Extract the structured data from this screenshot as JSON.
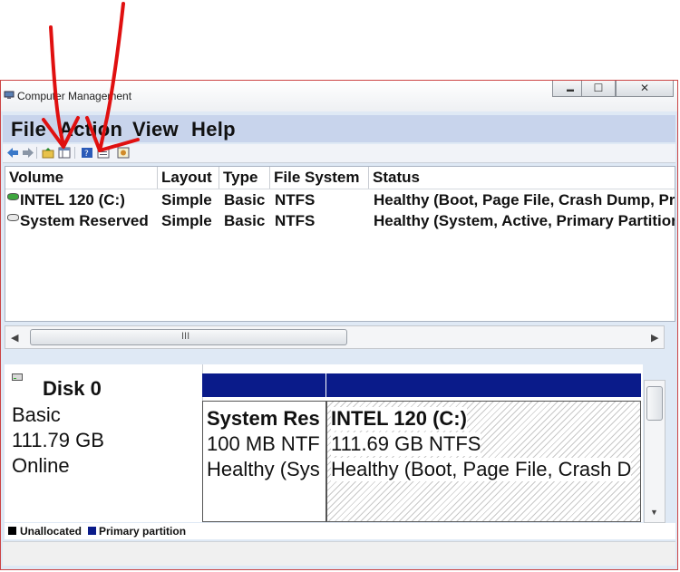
{
  "window": {
    "title": "Computer Management"
  },
  "caption_buttons": {
    "minimize": "▬",
    "maximize": "☐",
    "close": "✕"
  },
  "menu": {
    "items": [
      "File",
      "Action",
      "View",
      "Help"
    ]
  },
  "toolbar": {
    "icons": [
      "back-icon",
      "forward-icon",
      "up-folder-icon",
      "show-hide-tree-icon",
      "help-icon",
      "properties-icon",
      "snapin-icon"
    ]
  },
  "volume_list": {
    "columns": [
      "Volume",
      "Layout",
      "Type",
      "File System",
      "Status"
    ],
    "rows": [
      {
        "volume": "INTEL 120 (C:)",
        "layout": "Simple",
        "type": "Basic",
        "fs": "NTFS",
        "status": "Healthy (Boot, Page File, Crash Dump, Primary Partition)"
      },
      {
        "volume": "System Reserved",
        "layout": "Simple",
        "type": "Basic",
        "fs": "NTFS",
        "status": "Healthy (System, Active, Primary Partition)"
      }
    ]
  },
  "scrollbar": {
    "thumb_glyph": "III",
    "left_arrow": "◀",
    "right_arrow": "▶",
    "up_arrow": "▲",
    "down_arrow": "▼"
  },
  "disk": {
    "name": "Disk 0",
    "type": "Basic",
    "size": "111.79 GB",
    "state": "Online",
    "partitions": [
      {
        "name": "System Res",
        "size": "100 MB NTF",
        "status": "Healthy (Sys"
      },
      {
        "name": "INTEL 120  (C:)",
        "size": "111.69 GB NTFS",
        "status": "Healthy (Boot, Page File, Crash D"
      }
    ]
  },
  "legend": {
    "unallocated": "Unallocated",
    "primary": "Primary partition",
    "unallocated_color": "#000000",
    "primary_color": "#0a1b8a"
  },
  "colors": {
    "partition_header": "#0a1b8a",
    "menubar": "#c8d4ec",
    "annotation": "#e01010"
  }
}
